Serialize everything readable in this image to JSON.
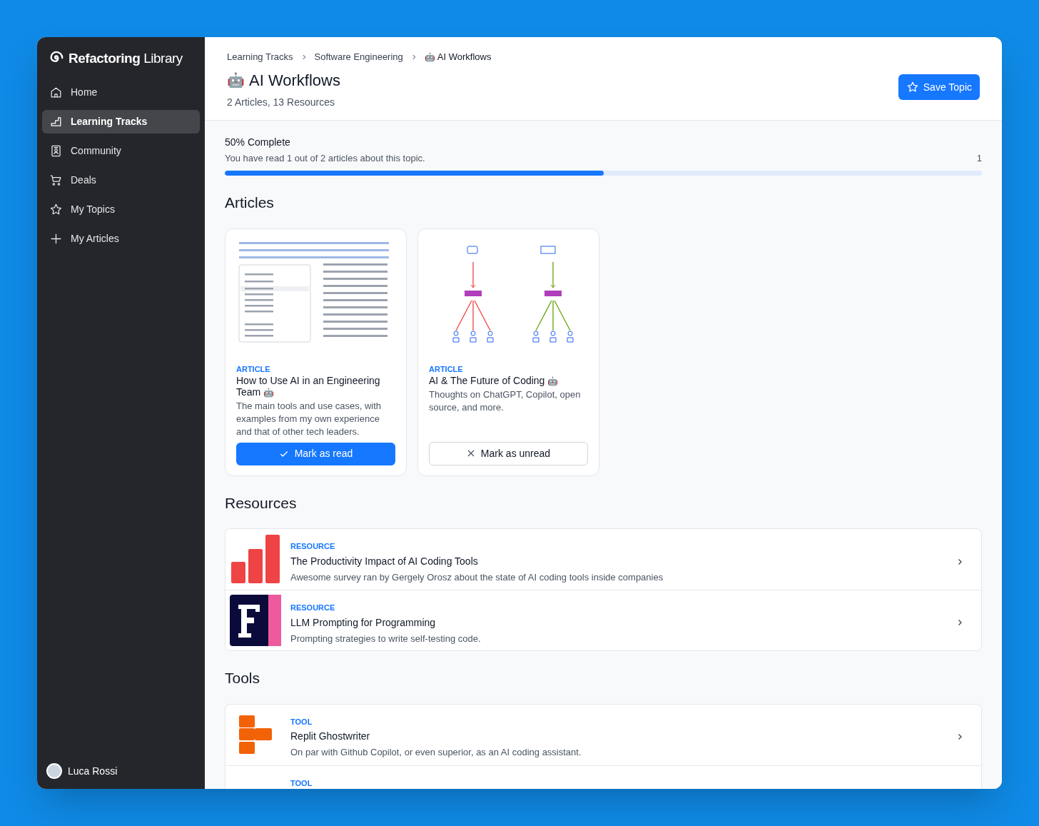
{
  "sidebar": {
    "logo": {
      "brand": "Refactoring",
      "suffix": "Library"
    },
    "items": [
      {
        "label": "Home",
        "selected": false
      },
      {
        "label": "Learning Tracks",
        "selected": true
      },
      {
        "label": "Community",
        "selected": false
      },
      {
        "label": "Deals",
        "selected": false
      },
      {
        "label": "My Topics",
        "selected": false
      },
      {
        "label": "My Articles",
        "selected": false
      }
    ],
    "user": {
      "name": "Luca Rossi"
    }
  },
  "header": {
    "breadcrumbs": [
      {
        "label": "Learning Tracks"
      },
      {
        "label": "Software Engineering"
      },
      {
        "label": "AI Workflows",
        "emoji": "🤖"
      }
    ],
    "title": "AI Workflows",
    "emoji": "🤖",
    "subtitle": "2 Articles, 13 Resources",
    "save_button": "Save Topic"
  },
  "progress": {
    "title": "50% Complete",
    "text": "You have read 1 out of 2 articles about this topic.",
    "count": "1",
    "level": 0.5
  },
  "articles_heading": "Articles",
  "articles": [
    {
      "tag": "ARTICLE",
      "title": "How to Use AI in an Engineering Team",
      "emoji": "🤖",
      "description": "The main tools and use cases, with examples from my own experience and that of other tech leaders.",
      "read": false,
      "button": "Mark as read"
    },
    {
      "tag": "ARTICLE",
      "title": "AI & The Future of Coding",
      "emoji": "🤖",
      "description": "Thoughts on ChatGPT, Copilot, open source, and more.",
      "read": true,
      "button": "Mark as unread"
    }
  ],
  "resources_heading": "Resources",
  "resources": [
    {
      "tag": "RESOURCE",
      "title": "The Productivity Impact of AI Coding Tools",
      "description": "Awesome survey ran by Gergely Orosz about the state of AI coding tools inside companies"
    },
    {
      "tag": "RESOURCE",
      "title": "LLM Prompting for Programming",
      "description": "Prompting strategies to write self-testing code."
    }
  ],
  "tools_heading": "Tools",
  "tools": [
    {
      "tag": "TOOL",
      "title": "Replit Ghostwriter",
      "description": "On par with Github Copilot, or even superior, as an AI coding assistant."
    },
    {
      "tag": "TOOL"
    }
  ]
}
